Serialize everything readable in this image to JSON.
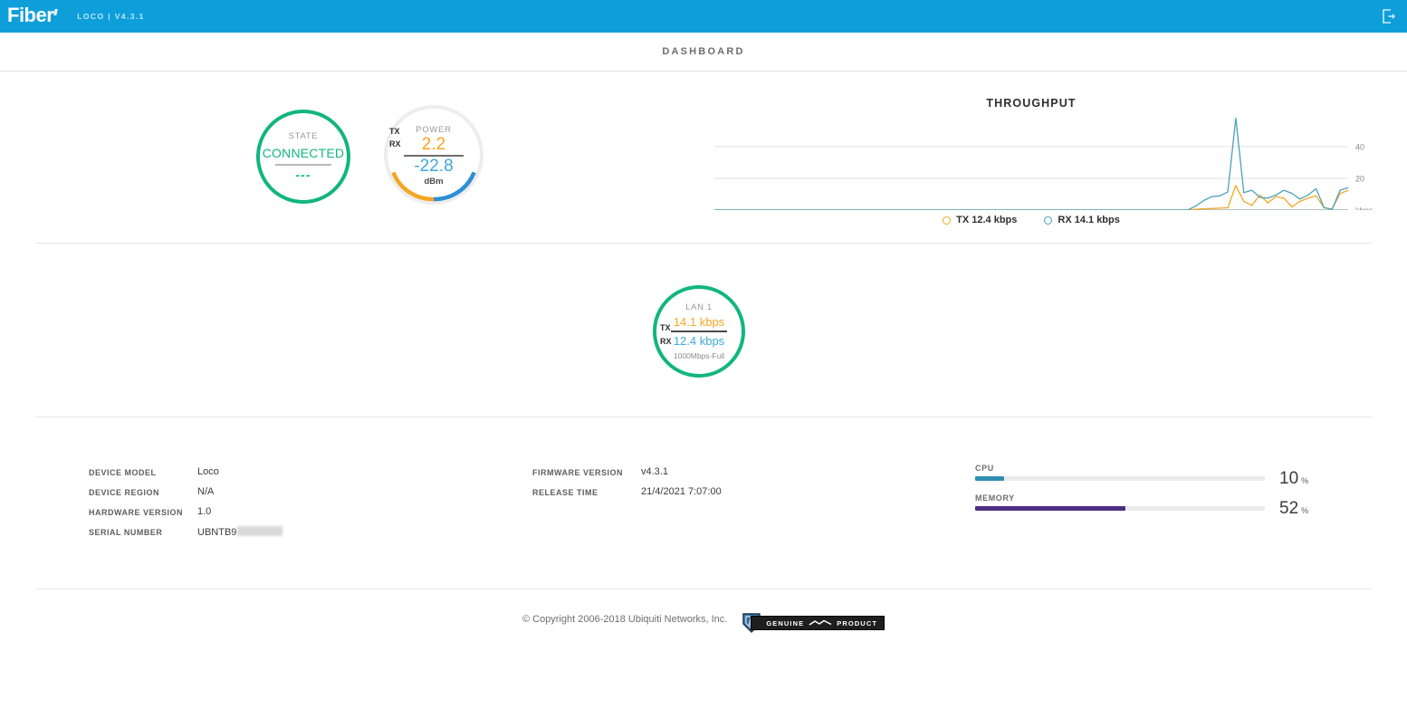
{
  "header": {
    "brand": "Fiber",
    "device_label": "LOCO | V4.3.1",
    "logout_icon": "logout-icon"
  },
  "nav": {
    "tabs": [
      {
        "label": "DASHBOARD",
        "active": true
      }
    ]
  },
  "state_gauge": {
    "title": "STATE",
    "value": "CONNECTED",
    "sub": "---",
    "ring_color": "#12b57f"
  },
  "power_gauge": {
    "title": "POWER",
    "tx_label": "TX",
    "rx_label": "RX",
    "tx_value": "2.2",
    "rx_value": "-22.8",
    "unit": "dBm",
    "tx_color": "#f5a623",
    "rx_color": "#3da9dd"
  },
  "throughput": {
    "title": "THROUGHPUT",
    "legend": [
      {
        "label": "TX 12.4 kbps",
        "color": "#f5a623"
      },
      {
        "label": "RX 14.1 kbps",
        "color": "#4ba3b8"
      }
    ]
  },
  "chart_data": {
    "type": "line",
    "title": "THROUGHPUT",
    "xlabel": "",
    "ylabel": "kbps",
    "ylim": [
      0,
      60
    ],
    "yticks": [
      0,
      20,
      40
    ],
    "ytick_labels": [
      "kbps",
      "20",
      "40"
    ],
    "grid": true,
    "legend_position": "bottom-center",
    "x": [
      0,
      1,
      2,
      3,
      4,
      5,
      6,
      7,
      8,
      9,
      10,
      11,
      12,
      13,
      14,
      15,
      16,
      17,
      18,
      19,
      20,
      21,
      22,
      23,
      24,
      25,
      26,
      27,
      28,
      29,
      30,
      31,
      32,
      33,
      34,
      35,
      36,
      37,
      38,
      39,
      40,
      41,
      42,
      43,
      44,
      45,
      46,
      47,
      48,
      49,
      50,
      51,
      52,
      53,
      54,
      55,
      56,
      57,
      58,
      59,
      60,
      61,
      62,
      63,
      64,
      65,
      66,
      67,
      68,
      69,
      70,
      71,
      72,
      73,
      74,
      75,
      76,
      77,
      78,
      79
    ],
    "series": [
      {
        "name": "TX",
        "color": "#f5a623",
        "current": 12.4,
        "unit": "kbps",
        "values": [
          0,
          0,
          0,
          0,
          0,
          0,
          0,
          0,
          0,
          0,
          0,
          0,
          0,
          0,
          0,
          0,
          0,
          0,
          0,
          0,
          0,
          0,
          0,
          0,
          0,
          0,
          0,
          0,
          0,
          0,
          0,
          0,
          0,
          0,
          0,
          0,
          0,
          0,
          0,
          0,
          0,
          0,
          0,
          0,
          0,
          0,
          0,
          0,
          0,
          0,
          0,
          0,
          0,
          0,
          0,
          0,
          0,
          0,
          0,
          0,
          0.5,
          0.8,
          1.0,
          1.2,
          1.4,
          15.5,
          5.5,
          3.0,
          9.5,
          4.5,
          8.5,
          7.5,
          2.0,
          5.5,
          7.5,
          9.0,
          1.5,
          0.6,
          10.5,
          12.4
        ]
      },
      {
        "name": "RX",
        "color": "#4ba3b8",
        "current": 14.1,
        "unit": "kbps",
        "values": [
          0,
          0,
          0,
          0,
          0,
          0,
          0,
          0,
          0,
          0,
          0,
          0,
          0,
          0,
          0,
          0,
          0,
          0,
          0,
          0,
          0,
          0,
          0,
          0,
          0,
          0,
          0,
          0,
          0,
          0,
          0,
          0,
          0,
          0,
          0,
          0,
          0,
          0,
          0,
          0,
          0,
          0,
          0,
          0,
          0,
          0,
          0,
          0,
          0,
          0,
          0,
          0,
          0,
          0,
          0,
          0,
          0,
          0,
          0,
          0,
          2.5,
          6.0,
          8.5,
          9.0,
          11.5,
          58.0,
          11.0,
          12.5,
          8.0,
          7.5,
          9.5,
          12.5,
          10.5,
          7.0,
          9.5,
          13.5,
          1.5,
          0.5,
          12.5,
          14.1
        ]
      }
    ]
  },
  "lan_gauge": {
    "title": "LAN 1",
    "tx_label": "TX",
    "rx_label": "RX",
    "tx_value": "14.1 kbps",
    "rx_value": "12.4 kbps",
    "sub": "1000Mbps-Full",
    "ring_color": "#12b57f"
  },
  "device_info": {
    "rows": [
      {
        "key": "DEVICE MODEL",
        "value": "Loco"
      },
      {
        "key": "DEVICE REGION",
        "value": "N/A"
      },
      {
        "key": "HARDWARE VERSION",
        "value": "1.0"
      },
      {
        "key": "SERIAL NUMBER",
        "value": "UBNTB9"
      }
    ]
  },
  "firmware_info": {
    "rows": [
      {
        "key": "FIRMWARE VERSION",
        "value": "v4.3.1"
      },
      {
        "key": "RELEASE TIME",
        "value": "21/4/2021 7:07:00"
      }
    ]
  },
  "meters": [
    {
      "label": "CPU",
      "value": "10",
      "unit": "%",
      "percent": 10,
      "color": "#2e8fb0"
    },
    {
      "label": "MEMORY",
      "value": "52",
      "unit": "%",
      "percent": 52,
      "color": "#4b2e83"
    }
  ],
  "footer": {
    "copyright": "© Copyright 2006-2018 Ubiquiti Networks, Inc.",
    "badge_left": "GENUINE",
    "badge_right": "PRODUCT"
  }
}
